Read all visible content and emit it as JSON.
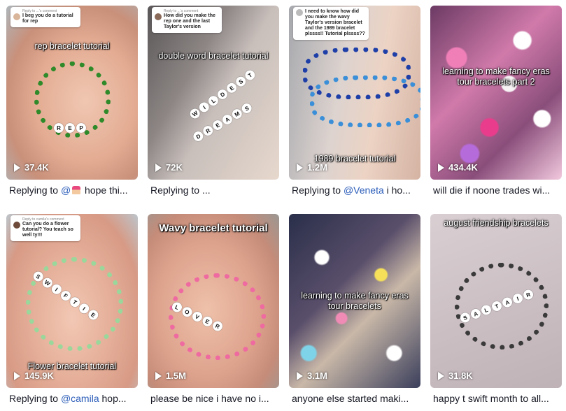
{
  "videos": [
    {
      "overlay": "rep bracelet tutorial",
      "comment": {
        "reply": "Reply to ...'s comment",
        "text": "I beg you do a tutorial for rep"
      },
      "views": "37.4K",
      "caption": {
        "prefix": "Replying to ",
        "mention": "@",
        "suffix": " hope thi..."
      }
    },
    {
      "overlay": "double word bracelet tutorial",
      "comment": {
        "reply": "Reply to ...'s comment",
        "text": "How did you make the rep one and the last Taylor's version"
      },
      "views": "72K",
      "caption": {
        "prefix": "Replying to ...",
        "mention": "",
        "suffix": ""
      }
    },
    {
      "overlay": "1989 bracelet tutorial",
      "comment": {
        "reply": "",
        "text": "I need to know how did you make the wavy Taylor's version bracelet and the 1989 bracelet plssss!! Tutorial plssss??"
      },
      "views": "1.2M",
      "caption": {
        "prefix": "Replying to ",
        "mention": "@Veneta",
        "suffix": " i ho..."
      }
    },
    {
      "overlay": "learning to make fancy eras tour bracelets part 2",
      "views": "434.4K",
      "caption": {
        "prefix": "will die if noone trades wi...",
        "mention": "",
        "suffix": ""
      }
    },
    {
      "overlay": "Flower bracelet tutorial",
      "comment": {
        "reply": "Reply to camila's comment",
        "text": "Can you do a flower tutorial? You teach so well ty!!!"
      },
      "views": "145.9K",
      "caption": {
        "prefix": "Replying to ",
        "mention": "@camila",
        "suffix": " hop..."
      }
    },
    {
      "overlay": "Wavy bracelet tutorial",
      "views": "1.5M",
      "caption": {
        "prefix": "please be nice i have no i...",
        "mention": "",
        "suffix": ""
      }
    },
    {
      "overlay": "learning to make fancy eras tour bracelets",
      "views": "3.1M",
      "caption": {
        "prefix": "anyone else started maki...",
        "mention": "",
        "suffix": ""
      }
    },
    {
      "overlay": "august friendship bracelets",
      "views": "31.8K",
      "caption": {
        "prefix": "happy t swift month to all...",
        "mention": "",
        "suffix": ""
      }
    }
  ],
  "bracelet_words": {
    "v1": [
      "R",
      "E",
      "P"
    ],
    "v2a": [
      "W",
      "I",
      "L",
      "D",
      "E",
      "S",
      "T"
    ],
    "v2b": [
      "D",
      "R",
      "E",
      "A",
      "M",
      "S"
    ],
    "v5": [
      "S",
      "W",
      "I",
      "F",
      "T",
      "I",
      "E"
    ],
    "v6": [
      "L",
      "O",
      "V",
      "E",
      "R"
    ],
    "v8": [
      "S",
      "A",
      "L",
      "T",
      "A",
      "I",
      "R"
    ]
  },
  "colors": {
    "mention": "#2b5db9",
    "text": "#161823"
  }
}
